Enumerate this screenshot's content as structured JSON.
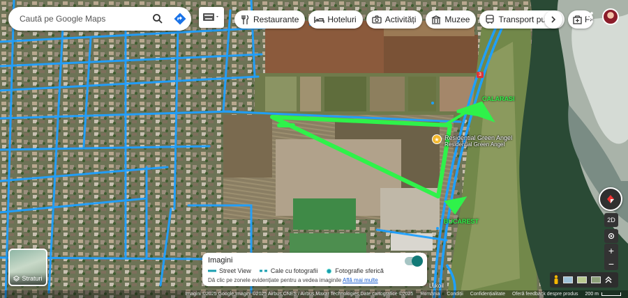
{
  "search": {
    "placeholder": "Caută pe Google Maps"
  },
  "categories": [
    {
      "label": "Restaurante",
      "icon": "fork-knife-icon"
    },
    {
      "label": "Hoteluri",
      "icon": "bed-icon"
    },
    {
      "label": "Activități",
      "icon": "camera-icon"
    },
    {
      "label": "Muzee",
      "icon": "museum-icon"
    },
    {
      "label": "Transport public",
      "icon": "train-icon"
    },
    {
      "label": "Far",
      "icon": "pharmacy-icon"
    }
  ],
  "layers": {
    "label": "Straturi"
  },
  "imagery_panel": {
    "title": "Imagini",
    "legend": [
      {
        "label": "Street View",
        "style": "solid"
      },
      {
        "label": "Cale cu fotografii",
        "style": "dashed"
      },
      {
        "label": "Fotografie sferică",
        "style": "dot"
      }
    ],
    "hint": "Dă clic pe zonele evidențiate pentru a vedea imaginile",
    "link": "Află mai multe",
    "toggle_on": true
  },
  "map": {
    "poi": {
      "name": "Residential Green Angel",
      "name_sub": "Residential Green Angel"
    },
    "highway_labels": {
      "north": "CALARASI",
      "south": "BUCAREST"
    },
    "route_number": "3",
    "bottom_place": "Lukoil",
    "accent_colors": {
      "street_view": "#1ea0ff",
      "annotation": "#2ff24a"
    }
  },
  "controls": {
    "mode_2d": "2D"
  },
  "attribution": {
    "imagery": "Imagini ©2025 Google,Imagini ©2025 Airbus,CNES / Airbus,Maxar Technologies,Date cartografice ©2025",
    "country": "România",
    "terms": "Condiții",
    "privacy": "Confidențialitate",
    "feedback": "Oferă feedback despre produs",
    "scale": "200 m"
  }
}
